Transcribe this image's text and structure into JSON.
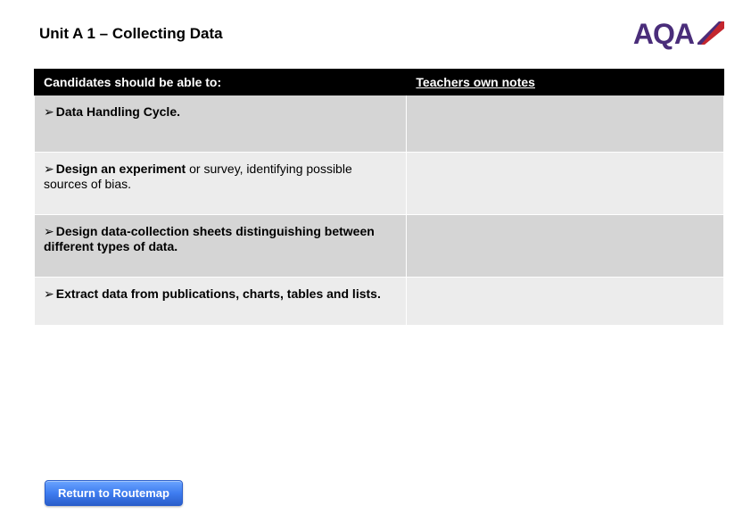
{
  "header": {
    "title": "Unit A 1 – Collecting Data",
    "logo_text": "AQA"
  },
  "table": {
    "headers": {
      "left": "Candidates should be able to:",
      "right": "Teachers own notes"
    },
    "rows": [
      {
        "text_bold": "Data Handling Cycle.",
        "text_rest": "",
        "notes": ""
      },
      {
        "text_bold": "Design an experiment",
        "text_rest": " or survey, identifying possible sources of bias.",
        "notes": ""
      },
      {
        "text_bold": "Design data-collection sheets distinguishing between different types of data.",
        "text_rest": "",
        "notes": ""
      },
      {
        "text_bold": "Extract data from publications, charts, tables and lists.",
        "text_rest": "",
        "notes": ""
      }
    ]
  },
  "footer": {
    "button_label": "Return to Routemap"
  },
  "colors": {
    "brand_purple": "#4a2d7a",
    "brand_red": "#c4262e",
    "button_blue": "#3f7df0"
  }
}
